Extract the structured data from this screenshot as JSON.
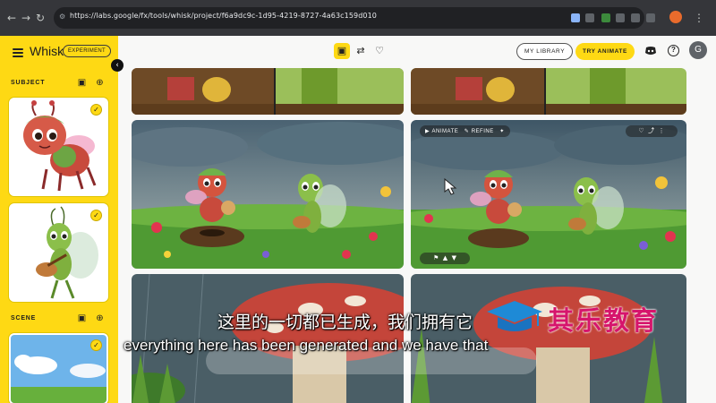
{
  "browser": {
    "url": "https://labs.google/fx/tools/whisk/project/f6a9dc9c-1d95-4219-8727-4a63c159d010",
    "back_icon": "back-arrow-icon",
    "forward_icon": "forward-arrow-icon",
    "reload_icon": "reload-icon"
  },
  "app": {
    "brand": "Whisk",
    "badge": "EXPERIMENT",
    "accent": "#fed914"
  },
  "sidebar": {
    "subject_title": "SUBJECT",
    "scene_title": "SCENE"
  },
  "toolbar": {
    "my_library": "MY LIBRARY",
    "try_animate": "TRY ANIMATE",
    "avatar_letter": "G"
  },
  "tile_overlay": {
    "animate": "ANIMATE",
    "refine": "REFINE"
  },
  "subtitles": {
    "zh": "这里的一切都已生成，我们拥有它",
    "en": "everything here has been generated and we have that"
  },
  "watermark": {
    "text": "其乐教育"
  }
}
